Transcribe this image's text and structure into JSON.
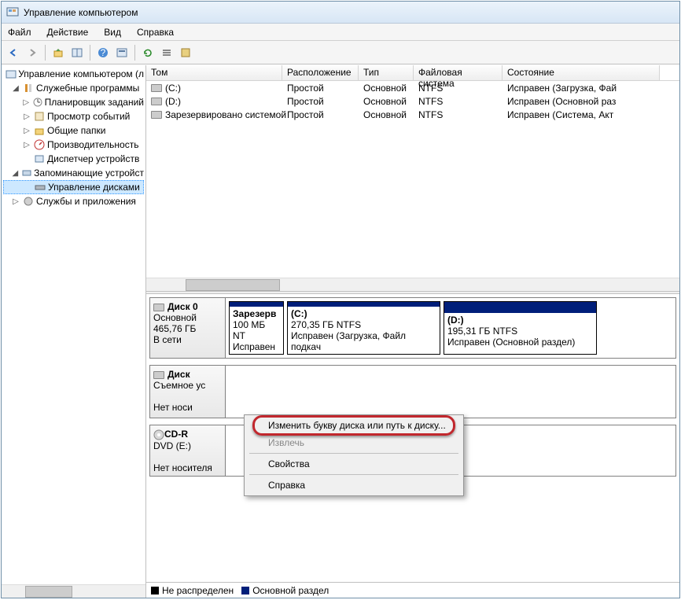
{
  "title": "Управление компьютером",
  "menu": {
    "file": "Файл",
    "action": "Действие",
    "view": "Вид",
    "help": "Справка"
  },
  "tree": {
    "root": "Управление компьютером (л",
    "system_tools": "Служебные программы",
    "scheduler": "Планировщик заданий",
    "eventviewer": "Просмотр событий",
    "shared": "Общие папки",
    "perf": "Производительность",
    "devmgr": "Диспетчер устройств",
    "storage": "Запоминающие устройст",
    "diskmgmt": "Управление дисками",
    "services": "Службы и приложения"
  },
  "cols": {
    "tom": "Том",
    "ras": "Расположение",
    "tip": "Тип",
    "fs": "Файловая система",
    "st": "Состояние"
  },
  "vols": [
    {
      "tom": "(C:)",
      "ras": "Простой",
      "tip": "Основной",
      "fs": "NTFS",
      "st": "Исправен (Загрузка, Фай"
    },
    {
      "tom": "(D:)",
      "ras": "Простой",
      "tip": "Основной",
      "fs": "NTFS",
      "st": "Исправен (Основной раз"
    },
    {
      "tom": "Зарезервировано системой",
      "ras": "Простой",
      "tip": "Основной",
      "fs": "NTFS",
      "st": "Исправен (Система, Акт"
    }
  ],
  "disk0": {
    "name": "Диск 0",
    "type": "Основной",
    "size": "465,76 ГБ",
    "status": "В сети",
    "p0": {
      "t": "Зарезерв",
      "s": "100 МБ NT",
      "st": "Исправен"
    },
    "p1": {
      "t": "(C:)",
      "s": "270,35 ГБ NTFS",
      "st": "Исправен (Загрузка, Файл подкач"
    },
    "p2": {
      "t": "(D:)",
      "s": "195,31 ГБ NTFS",
      "st": "Исправен (Основной раздел)"
    }
  },
  "disk1": {
    "name": "Диск",
    "type": "Съемное ус",
    "st": "Нет носи"
  },
  "cdrom": {
    "name": "CD-R",
    "type": "DVD (E:)",
    "st": "Нет носителя"
  },
  "legend": {
    "un": "Не распределен",
    "pr": "Основной раздел"
  },
  "ctx": {
    "chg": "Изменить букву диска или путь к диску...",
    "ej": "Извлечь",
    "prop": "Свойства",
    "help": "Справка"
  }
}
